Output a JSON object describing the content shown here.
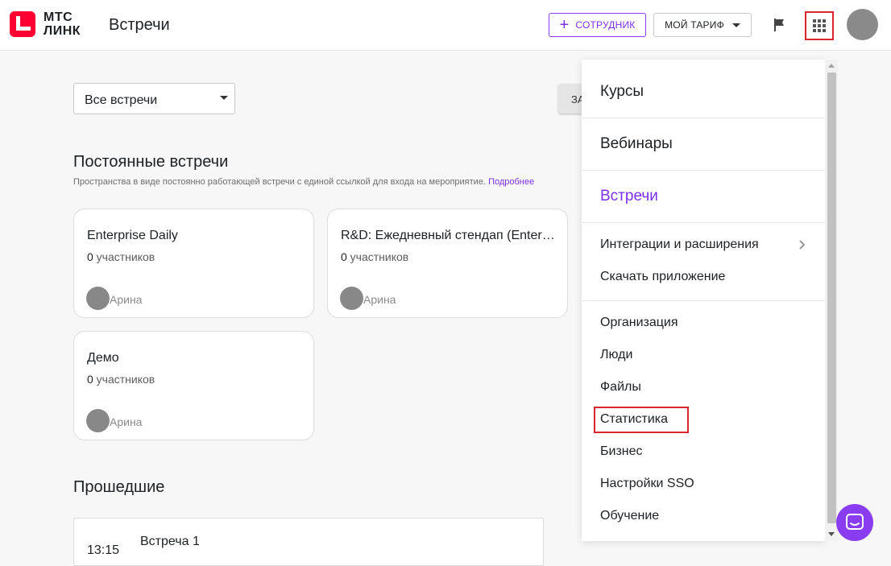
{
  "header": {
    "logo_line1": "МТС",
    "logo_line2": "ЛИНК",
    "app_title": "Встречи",
    "employee_button": "Сотрудник",
    "tariff_button": "МОЙ ТАРИФ",
    "icons": [
      "flag-icon",
      "apps-grid-icon",
      "user-avatar"
    ]
  },
  "filter": {
    "selected": "Все встречи"
  },
  "hidden_button_label": "ЗА",
  "permanent": {
    "title": "Постоянные встречи",
    "subtitle": "Пространства в виде постоянно работающей встречи с единой ссылкой для входа на мероприятие.",
    "more_link": "Подробнее",
    "cards": [
      {
        "title": "Enterprise Daily",
        "count": "0",
        "count_suffix": " участников",
        "owner": "Арина"
      },
      {
        "title": "R&D: Ежедневный стендап (Enterprise)",
        "count": "0",
        "count_suffix": " участников",
        "owner": "Арина"
      },
      {
        "title": "Демо",
        "count": "0",
        "count_suffix": " участников",
        "owner": "Арина"
      }
    ]
  },
  "past": {
    "title": "Прошедшие",
    "items": [
      {
        "time": "13:15",
        "name": "Встреча 1"
      }
    ]
  },
  "menu": {
    "products": [
      {
        "label": "Курсы",
        "active": false
      },
      {
        "label": "Вебинары",
        "active": false
      },
      {
        "label": "Встречи",
        "active": true
      }
    ],
    "group1": [
      "Интеграции и расширения",
      "Скачать приложение"
    ],
    "group2": [
      "Организация",
      "Люди",
      "Файлы",
      "Статистика",
      "Бизнес",
      "Настройки SSO",
      "Обучение"
    ]
  },
  "colors": {
    "accent": "#7b2fe8",
    "highlight": "#d9262e",
    "brand_red": "#ff0032"
  }
}
